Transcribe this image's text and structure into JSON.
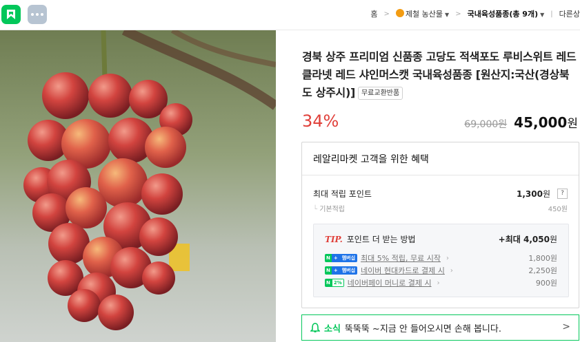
{
  "topbar": {
    "breadcrumb": {
      "home": "홈",
      "store": "제철 농산물",
      "category": "국내육성품종(총 9개)",
      "next": "다른상"
    }
  },
  "product": {
    "title": "경북 상주 프리미엄 신품종 고당도 적색포도 루비스위트 레드클라넷 레드 샤인머스캣 국내육성품종 [원산지:국산(경상북도 상주시)]",
    "badge": "무료교환반품",
    "discount": "34%",
    "original_price": "69,000원",
    "price_number": "45,000",
    "price_unit": "원"
  },
  "benefit": {
    "heading": "레알리마켓 고객을 위한 혜택",
    "max_points_label": "최대 적립 포인트",
    "max_points_value": "1,300",
    "won": "원",
    "help": "?",
    "base_label": "기본적립",
    "base_value": "450원",
    "tip": {
      "mark": "TIP.",
      "label": "포인트 더 받는 방법",
      "max_prefix": "+최대",
      "max_value": "4,050",
      "items": [
        {
          "badge": "멤버십",
          "text": "최대 5% 적립, 무료 시작",
          "value": "1,800원"
        },
        {
          "badge": "멤버십",
          "text": "네이버 현대카드로 결제 시",
          "value": "2,250원"
        },
        {
          "badge": "2%",
          "text": "네이버페이 머니로 결제 시",
          "value": "900원"
        }
      ]
    }
  },
  "notice": {
    "tag": "소식",
    "text": "뚝뚝뚝 ~지금 안 들어오시면 손해 봅니다."
  },
  "colors": {
    "brand_green": "#03c75a",
    "discount_red": "#e0403a",
    "more_button": "#b7c4d2"
  },
  "icons": [
    "store-home-icon",
    "more-dots-icon",
    "store-logo-icon",
    "chevron-down-icon",
    "bell-icon",
    "chevron-right-icon"
  ]
}
